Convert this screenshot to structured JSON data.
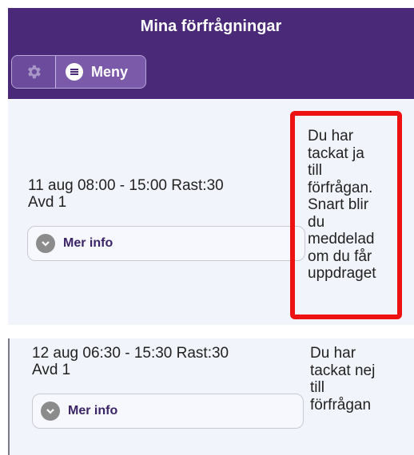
{
  "header": {
    "title": "Mina förfrågningar",
    "menu_label": "Meny",
    "settings_icon": "gear-icon",
    "menu_icon": "hamburger-icon"
  },
  "requests": [
    {
      "time_line": "11 aug 08:00 - 15:00 Rast:30",
      "dept": "Avd 1",
      "more_info_label": "Mer info",
      "status_lines": [
        "Du har",
        "tackat ja",
        "till",
        "förfrågan.",
        "Snart blir",
        "du",
        "meddelad",
        "om du får",
        "uppdraget"
      ]
    },
    {
      "time_line": "12 aug 06:30 - 15:30 Rast:30",
      "dept": "Avd 1",
      "more_info_label": "Mer info",
      "status_lines": [
        "Du har",
        "tackat nej",
        "till",
        "förfrågan"
      ]
    }
  ],
  "colors": {
    "header": "#4a2a78",
    "card": "#f2f4fc",
    "highlight": "#ee1111"
  }
}
